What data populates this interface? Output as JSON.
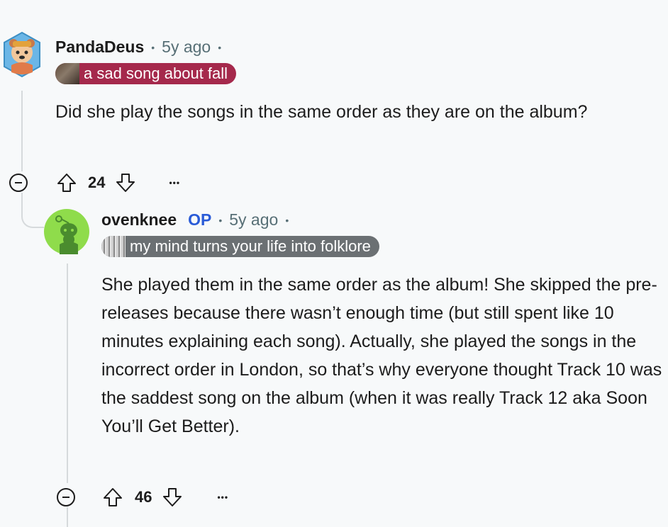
{
  "comments": [
    {
      "username": "PandaDeus",
      "sep1": "•",
      "time": "5y ago",
      "sep2": "•",
      "flair": {
        "text": "a sad song about fall",
        "color": "#a5294c"
      },
      "body": "Did she play the songs in the same order as they are on the album?",
      "votes": "24",
      "more": "•••"
    },
    {
      "username": "ovenknee",
      "op_label": "OP",
      "sep1": "•",
      "time": "5y ago",
      "sep2": "•",
      "flair": {
        "text": "my mind turns your life into folklore",
        "color": "#6b7073"
      },
      "body": "She played them in the same order as the album! She skipped the pre-releases because there wasn’t enough time (but still spent like 10 minutes explaining each song). Actually, she played the songs in the incorrect order in London, so that’s why everyone thought Track 10 was the saddest song on the album (when it was really Track 12 aka Soon You’ll Get Better).",
      "votes": "46",
      "more": "•••"
    }
  ],
  "icons": {
    "collapse": "collapse-icon",
    "upvote": "upvote-icon",
    "downvote": "downvote-icon",
    "more": "more-icon"
  }
}
